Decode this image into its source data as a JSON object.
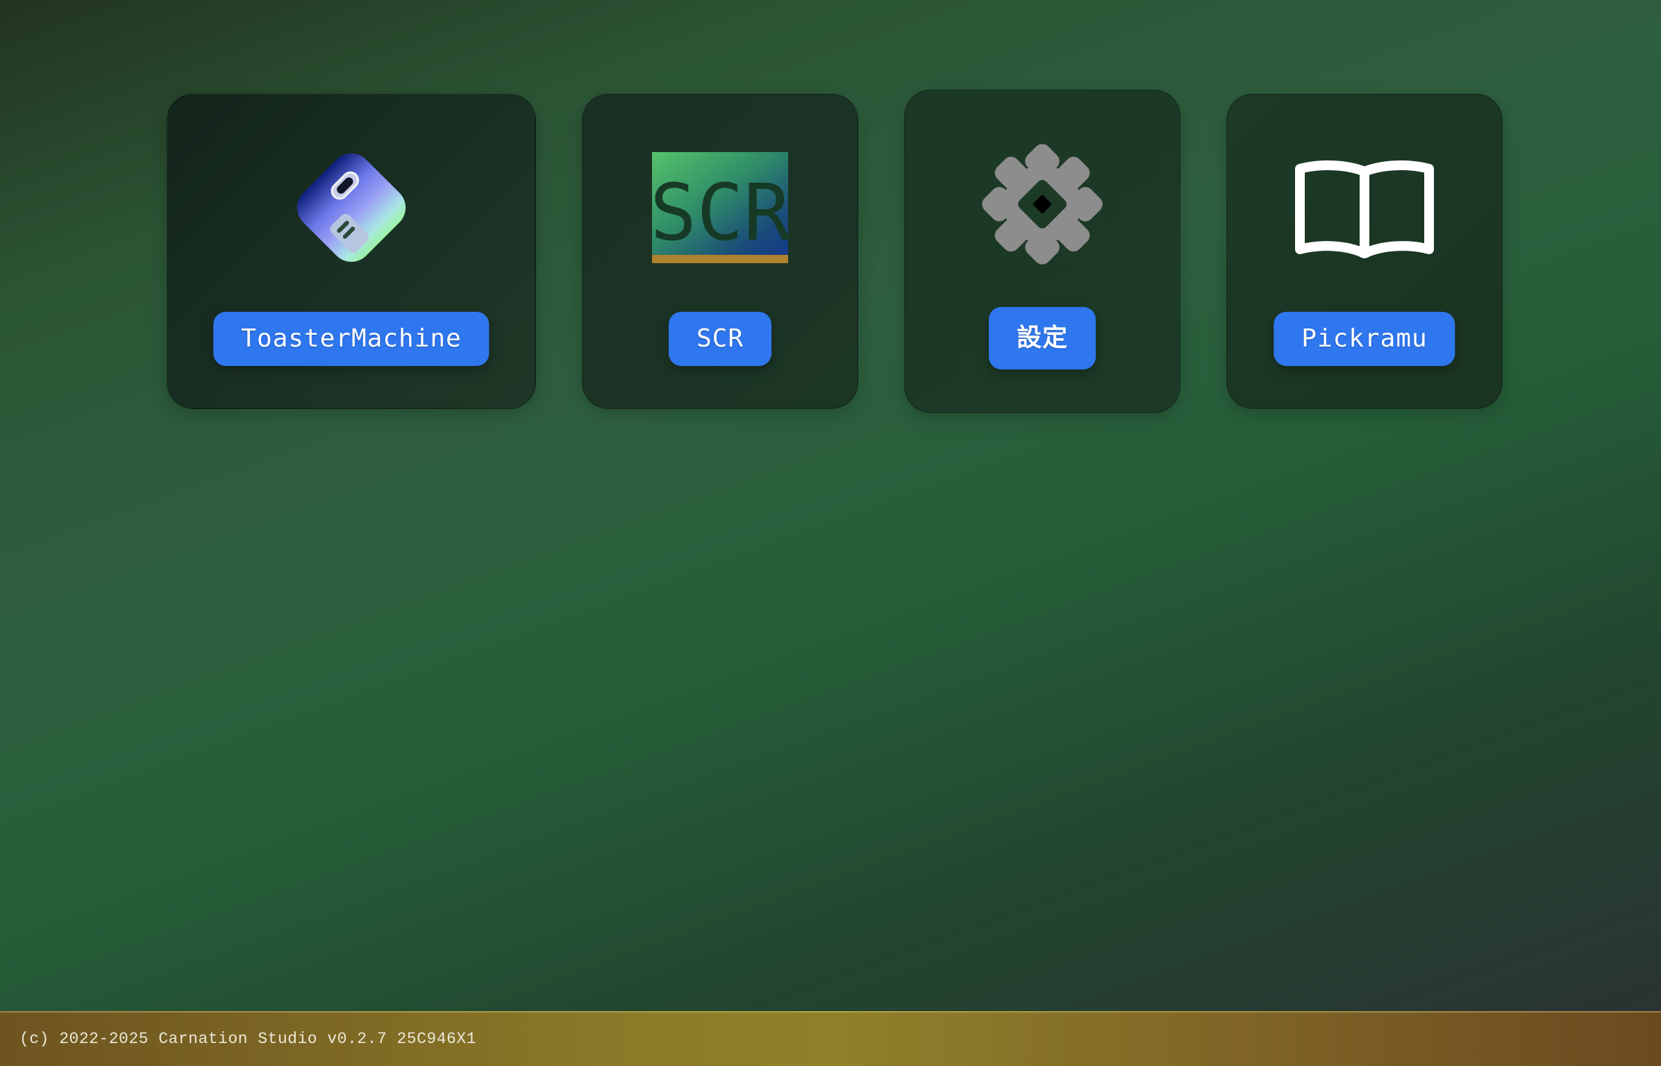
{
  "apps": [
    {
      "label": "ToasterMachine",
      "icon": "toaster-machine-icon"
    },
    {
      "label": "SCR",
      "icon": "scr-icon",
      "icon_text": "SCR"
    },
    {
      "label": "設定",
      "icon": "gear-icon"
    },
    {
      "label": "Pickramu",
      "icon": "open-book-icon"
    }
  ],
  "footer": {
    "text": "(c) 2022-2025 Carnation Studio v0.2.7 25C946X1"
  },
  "colors": {
    "button": "#2f77ef",
    "card": "#1c3625",
    "status_bar": "#8b7a28",
    "gear": "#8d8d8d"
  }
}
